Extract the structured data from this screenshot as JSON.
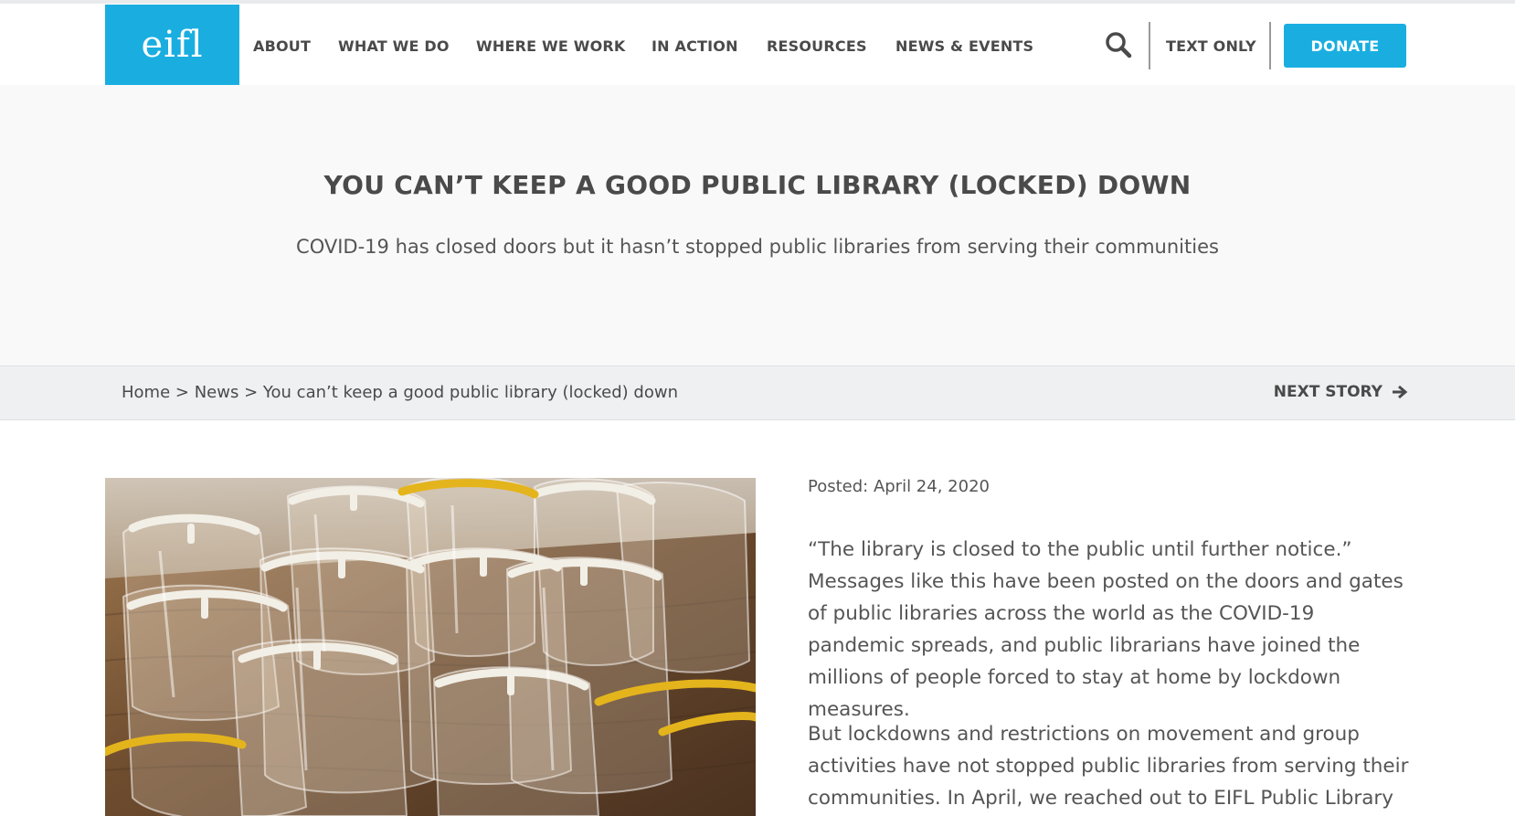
{
  "brand": {
    "logo_text": "eifl",
    "accent_color": "#1aaee0"
  },
  "nav": {
    "items": [
      {
        "label": "ABOUT"
      },
      {
        "label": "WHAT WE DO"
      },
      {
        "label": "WHERE WE WORK"
      },
      {
        "label": "IN ACTION"
      },
      {
        "label": "RESOURCES"
      },
      {
        "label": "NEWS & EVENTS"
      }
    ],
    "search_icon": "search-icon",
    "text_only_label": "TEXT ONLY",
    "donate_label": "DONATE"
  },
  "hero": {
    "title": "YOU CAN’T KEEP A GOOD PUBLIC LIBRARY (LOCKED) DOWN",
    "subtitle": "COVID-19 has closed doors but it hasn’t stopped public libraries from serving their communities"
  },
  "breadcrumb": {
    "items": [
      "Home",
      "News",
      "You can’t keep a good public library (locked) down"
    ],
    "separator": ">"
  },
  "next_story": {
    "label": "NEXT STORY",
    "icon": "arrow-right-icon"
  },
  "article": {
    "posted": "Posted: April 24, 2020",
    "paragraphs": [
      "“The library is closed to the public until further notice.” Messages like this have been posted on the doors and gates of public libraries across the world as the COVID-19 pandemic spreads, and public librarians have joined the millions of people forced to stay at home by lockdown measures.",
      "But lockdowns and restrictions on movement and group activities have not stopped public libraries from serving their communities. In April, we reached out to EIFL Public Library"
    ]
  }
}
